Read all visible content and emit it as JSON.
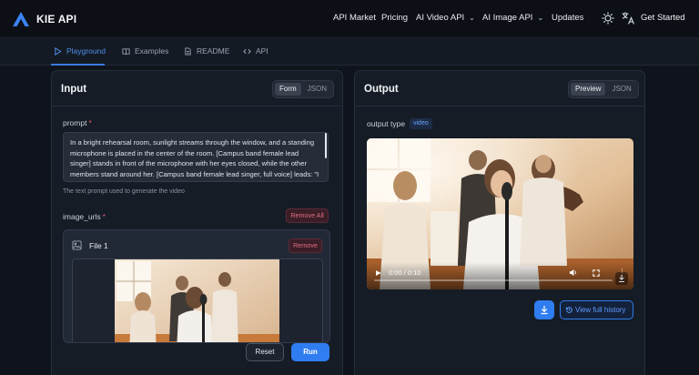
{
  "brand": {
    "name": "KIE API"
  },
  "nav": {
    "items": [
      {
        "label": "API Market"
      },
      {
        "label": "Pricing"
      },
      {
        "label": "AI Video API",
        "has_dropdown": true
      },
      {
        "label": "AI Image API",
        "has_dropdown": true
      },
      {
        "label": "Updates"
      }
    ],
    "get_started": "Get Started",
    "icons": [
      "sun-icon",
      "translate-icon"
    ]
  },
  "tabs": [
    {
      "label": "Playground",
      "icon": "play-icon",
      "active": true
    },
    {
      "label": "Examples",
      "icon": "book-icon",
      "active": false
    },
    {
      "label": "README",
      "icon": "document-icon",
      "active": false
    },
    {
      "label": "API",
      "icon": "code-icon",
      "active": false
    }
  ],
  "input_panel": {
    "title": "Input",
    "modes": [
      {
        "label": "Form",
        "active": true
      },
      {
        "label": "JSON",
        "active": false
      }
    ],
    "prompt": {
      "label": "prompt",
      "required_mark": "*",
      "value": "In a bright rehearsal room, sunlight streams through the window, and a standing microphone is placed in the center of the room. [Campus band female lead singer] stands in front of the microphone with her eyes closed, while the other members stand around her. [Campus band female lead singer, full voice] leads: \"I will try to fix you, with all my heart and soul...\" The",
      "helper": "The text prompt used to generate the video"
    },
    "image_urls": {
      "label": "image_urls",
      "required_mark": "*",
      "remove_all": "Remove All",
      "file": {
        "title": "File 1",
        "remove": "Remove"
      }
    },
    "reset": "Reset",
    "run": "Run"
  },
  "output_panel": {
    "title": "Output",
    "modes": [
      {
        "label": "Preview",
        "active": true
      },
      {
        "label": "JSON",
        "active": false
      }
    ],
    "output_type_label": "output type",
    "output_type_value": "video",
    "video": {
      "time": "0:00 / 0:10",
      "progress": 0.0
    },
    "view_history": "View full history"
  },
  "colors": {
    "accent": "#2f7df0",
    "danger": "#e06f82",
    "background": "#0f131b"
  }
}
